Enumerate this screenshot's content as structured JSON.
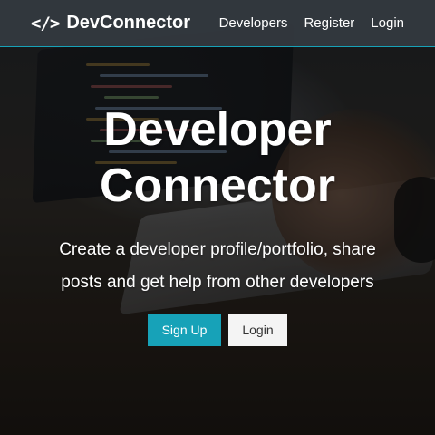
{
  "navbar": {
    "brand_icon": "</>",
    "brand_name": "DevConnector",
    "links": [
      "Developers",
      "Register",
      "Login"
    ]
  },
  "landing": {
    "title_line1": "Developer",
    "title_line2": "Connector",
    "lead_line1": "Create a developer profile/portfolio, share",
    "lead_line2": "posts and get help from other developers",
    "signup_label": "Sign Up",
    "login_label": "Login"
  },
  "colors": {
    "accent": "#17a2b8",
    "navbar": "#343a40",
    "light_button": "#f4f4f4"
  }
}
